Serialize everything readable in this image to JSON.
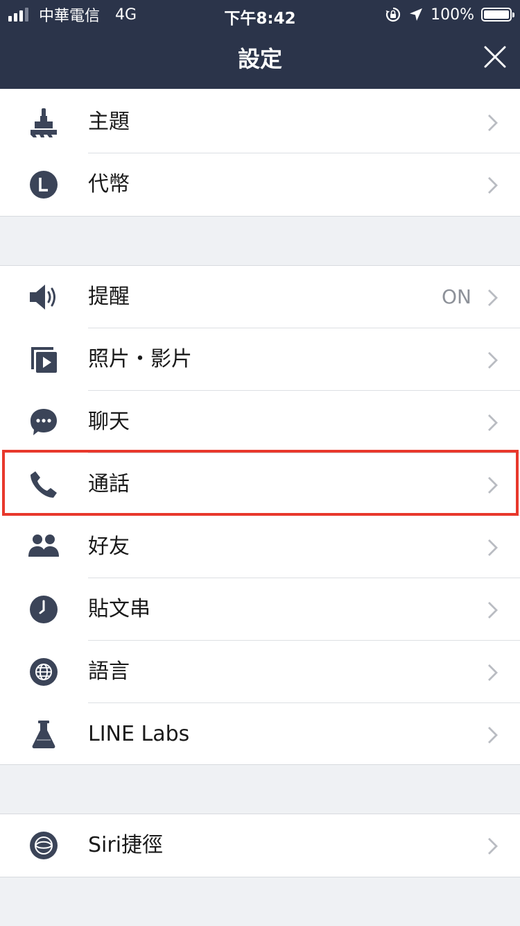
{
  "status_bar": {
    "carrier": "中華電信",
    "network": "4G",
    "time": "下午8:42",
    "battery": "100%",
    "battery_level": 1.0
  },
  "nav": {
    "title": "設定",
    "close_icon": "close-icon"
  },
  "colors": {
    "header_bg": "#2b344a",
    "icon": "#3b4458",
    "highlight": "#e8382c",
    "background": "#eff1f4"
  },
  "section1": {
    "items": [
      {
        "label": "主題",
        "icon": "brush-icon"
      },
      {
        "label": "代幣",
        "icon": "coin-icon"
      }
    ]
  },
  "section2": {
    "items": [
      {
        "label": "提醒",
        "value": "ON",
        "icon": "speaker-icon"
      },
      {
        "label": "照片・影片",
        "icon": "photo-video-icon"
      },
      {
        "label": "聊天",
        "icon": "chat-bubble-icon"
      },
      {
        "label": "通話",
        "icon": "phone-icon"
      },
      {
        "label": "好友",
        "icon": "friends-icon"
      },
      {
        "label": "貼文串",
        "icon": "clock-icon"
      },
      {
        "label": "語言",
        "icon": "globe-icon"
      },
      {
        "label": "LINE Labs",
        "icon": "flask-icon"
      }
    ]
  },
  "section3": {
    "items": [
      {
        "label": "Siri捷徑",
        "icon": "siri-icon"
      }
    ]
  }
}
